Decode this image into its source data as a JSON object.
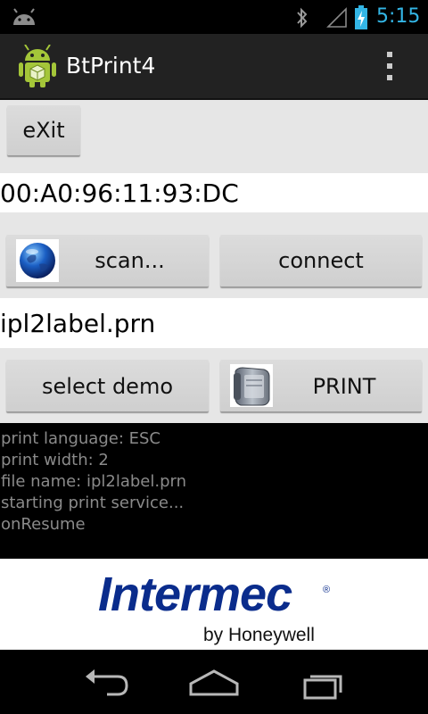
{
  "status_bar": {
    "time": "5:15",
    "accent_color": "#33b5e5",
    "icons": [
      "android-notification-icon",
      "bluetooth-icon",
      "signal-icon",
      "battery-charging-icon"
    ]
  },
  "action_bar": {
    "title": "BtPrint4",
    "app_icon": "android-robot-icon",
    "overflow_icon": "overflow-menu-icon"
  },
  "buttons": {
    "exit": "eXit",
    "scan": "scan...",
    "connect": "connect",
    "select_demo": "select demo",
    "print": "PRINT"
  },
  "device": {
    "mac_address": "00:A0:96:11:93:DC",
    "file_name": "ipl2label.prn"
  },
  "log": {
    "lines": [
      "print language: ESC",
      "print width: 2",
      "file name: ipl2label.prn",
      "starting print service...",
      "onResume"
    ]
  },
  "banner": {
    "brand": "Intermec",
    "registered": "®",
    "tagline": "by Honeywell",
    "brand_color": "#0a2c8c"
  },
  "nav_bar": {
    "buttons": [
      "back-icon",
      "home-icon",
      "recent-apps-icon"
    ]
  }
}
